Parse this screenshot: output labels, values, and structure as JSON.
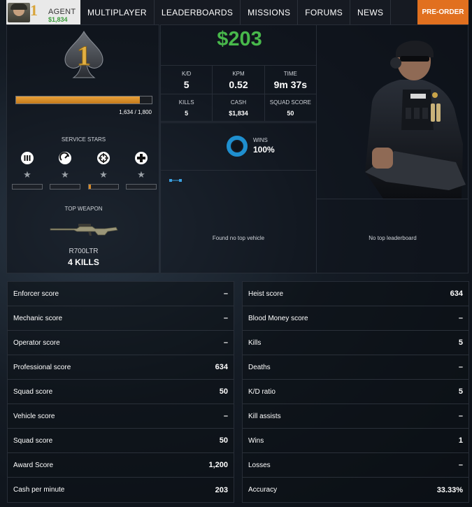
{
  "nav": {
    "agent_rank": "1",
    "agent_label": "AGENT",
    "agent_cash": "$1,834",
    "links": [
      "MULTIPLAYER",
      "LEADERBOARDS",
      "MISSIONS",
      "FORUMS",
      "NEWS"
    ],
    "preorder": "PRE-ORDER"
  },
  "rank": {
    "number": "1",
    "xp_text": "1,634 / 1,800",
    "xp_fraction": 0.91
  },
  "service_stars": {
    "title": "SERVICE STARS",
    "items": [
      {
        "icon": "ammo-icon",
        "star": "★",
        "progress": 0.0
      },
      {
        "icon": "gauge-icon",
        "star": "★",
        "progress": 0.0
      },
      {
        "icon": "crosshair-icon",
        "star": "★",
        "progress": 0.08
      },
      {
        "icon": "medic-cross-icon",
        "star": "★",
        "progress": 0.0
      }
    ]
  },
  "top_weapon": {
    "title": "TOP WEAPON",
    "name": "R700LTR",
    "kills": "4 KILLS"
  },
  "summary": {
    "cash_big": "$203",
    "stats_row1": [
      {
        "label": "K/D",
        "value": "5"
      },
      {
        "label": "KPM",
        "value": "0.52"
      },
      {
        "label": "TIME",
        "value": "9m 37s"
      }
    ],
    "stats_row2": [
      {
        "label": "KILLS",
        "value": "5"
      },
      {
        "label": "CASH",
        "value": "$1,834"
      },
      {
        "label": "SQUAD SCORE",
        "value": "50"
      }
    ],
    "wins_label": "WINS",
    "wins_value": "100%",
    "wins_fraction": 1.0,
    "no_vehicle": "Found no top vehicle",
    "no_leaderboard": "No top leaderboard"
  },
  "table_left": [
    {
      "label": "Enforcer score",
      "value": "–"
    },
    {
      "label": "Mechanic score",
      "value": "–"
    },
    {
      "label": "Operator score",
      "value": "–"
    },
    {
      "label": "Professional score",
      "value": "634"
    },
    {
      "label": "Squad score",
      "value": "50"
    },
    {
      "label": "Vehicle score",
      "value": "–"
    },
    {
      "label": "Squad score",
      "value": "50"
    },
    {
      "label": "Award Score",
      "value": "1,200"
    },
    {
      "label": "Cash per minute",
      "value": "203"
    }
  ],
  "table_right": [
    {
      "label": "Heist score",
      "value": "634"
    },
    {
      "label": "Blood Money score",
      "value": "–"
    },
    {
      "label": "Kills",
      "value": "5"
    },
    {
      "label": "Deaths",
      "value": "–"
    },
    {
      "label": "K/D ratio",
      "value": "5"
    },
    {
      "label": "Kill assists",
      "value": "–"
    },
    {
      "label": "Wins",
      "value": "1"
    },
    {
      "label": "Losses",
      "value": "–"
    },
    {
      "label": "Accuracy",
      "value": "33.33%"
    }
  ],
  "colors": {
    "accent_orange": "#e1701f",
    "cash_green": "#48b84b",
    "xp_orange": "#d98c27",
    "ring_blue": "#1f8fcf"
  }
}
